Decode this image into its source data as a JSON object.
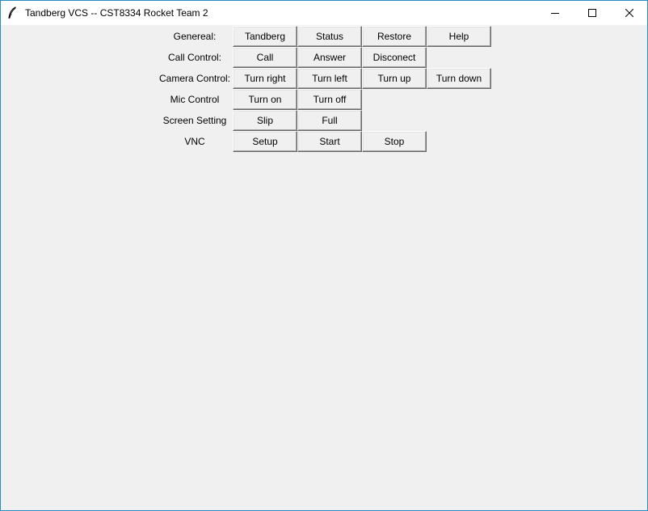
{
  "window": {
    "title": "Tandberg VCS -- CST8334 Rocket Team 2",
    "icons": {
      "app": "feather-icon",
      "minimize": "minimize-icon",
      "maximize": "maximize-icon",
      "close": "close-icon"
    }
  },
  "rows": [
    {
      "label": "Genereal:",
      "buttons": [
        "Tandberg",
        "Status",
        "Restore",
        "Help"
      ]
    },
    {
      "label": "Call Control:",
      "buttons": [
        "Call",
        "Answer",
        "Disconect"
      ]
    },
    {
      "label": "Camera Control:",
      "buttons": [
        "Turn right",
        "Turn left",
        "Turn up",
        "Turn down"
      ]
    },
    {
      "label": "Mic Control",
      "buttons": [
        "Turn on",
        "Turn off"
      ]
    },
    {
      "label": "Screen Setting",
      "buttons": [
        "Slip",
        "Full"
      ]
    },
    {
      "label": "VNC",
      "buttons": [
        "Setup",
        "Start",
        "Stop"
      ]
    }
  ]
}
